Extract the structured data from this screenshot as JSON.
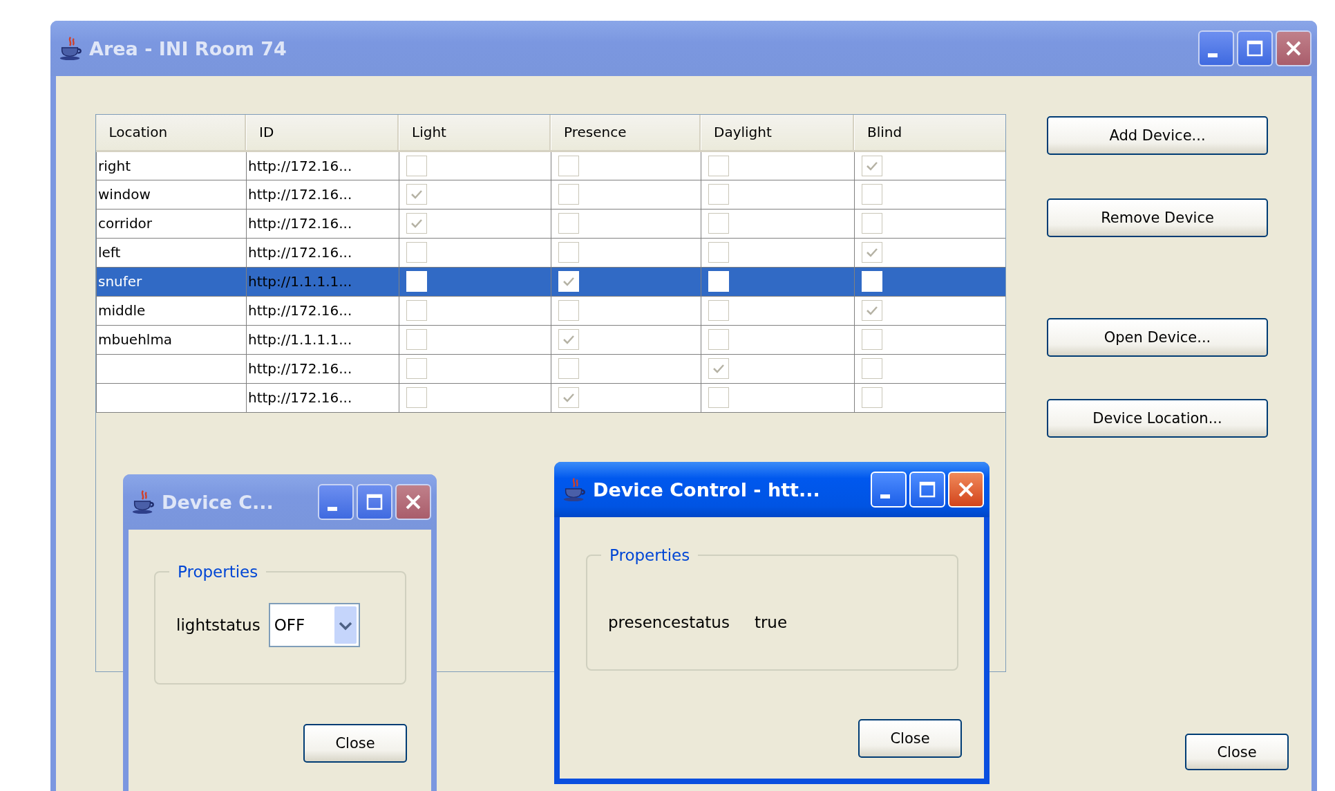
{
  "window": {
    "title": "Area - INI Room 74",
    "active": false
  },
  "table": {
    "columns": [
      "Location",
      "ID",
      "Light",
      "Presence",
      "Daylight",
      "Blind"
    ],
    "rows": [
      {
        "location": "right",
        "id": "http://172.16...",
        "light": false,
        "presence": false,
        "daylight": false,
        "blind": true,
        "selected": false
      },
      {
        "location": "window",
        "id": "http://172.16...",
        "light": true,
        "presence": false,
        "daylight": false,
        "blind": false,
        "selected": false
      },
      {
        "location": "corridor",
        "id": "http://172.16...",
        "light": true,
        "presence": false,
        "daylight": false,
        "blind": false,
        "selected": false
      },
      {
        "location": "left",
        "id": "http://172.16...",
        "light": false,
        "presence": false,
        "daylight": false,
        "blind": true,
        "selected": false
      },
      {
        "location": "snufer",
        "id": "http://1.1.1.1...",
        "light": false,
        "presence": true,
        "daylight": false,
        "blind": false,
        "selected": true
      },
      {
        "location": "middle",
        "id": "http://172.16...",
        "light": false,
        "presence": false,
        "daylight": false,
        "blind": true,
        "selected": false
      },
      {
        "location": "mbuehlma",
        "id": "http://1.1.1.1...",
        "light": false,
        "presence": true,
        "daylight": false,
        "blind": false,
        "selected": false
      },
      {
        "id": "http://172.16...",
        "light": false,
        "presence": false,
        "daylight": true,
        "blind": false,
        "selected": false
      },
      {
        "id": "http://172.16...",
        "light": false,
        "presence": true,
        "daylight": false,
        "blind": false,
        "selected": false
      }
    ]
  },
  "buttons": [
    "Add Device...",
    "Remove Device",
    "Open Device...",
    "Device Location..."
  ],
  "close_button": "Close",
  "dialogs": [
    {
      "title": "Device C...",
      "active": false,
      "group_title": "Properties",
      "fields": [
        {
          "kind": "dropdown",
          "label": "lightstatus",
          "value": "OFF"
        }
      ],
      "button": "Close"
    },
    {
      "title": "Device Control - htt...",
      "active": true,
      "group_title": "Properties",
      "fields": [
        {
          "kind": "text",
          "label": "presencestatus",
          "value": "true"
        }
      ],
      "button": "Close"
    }
  ]
}
